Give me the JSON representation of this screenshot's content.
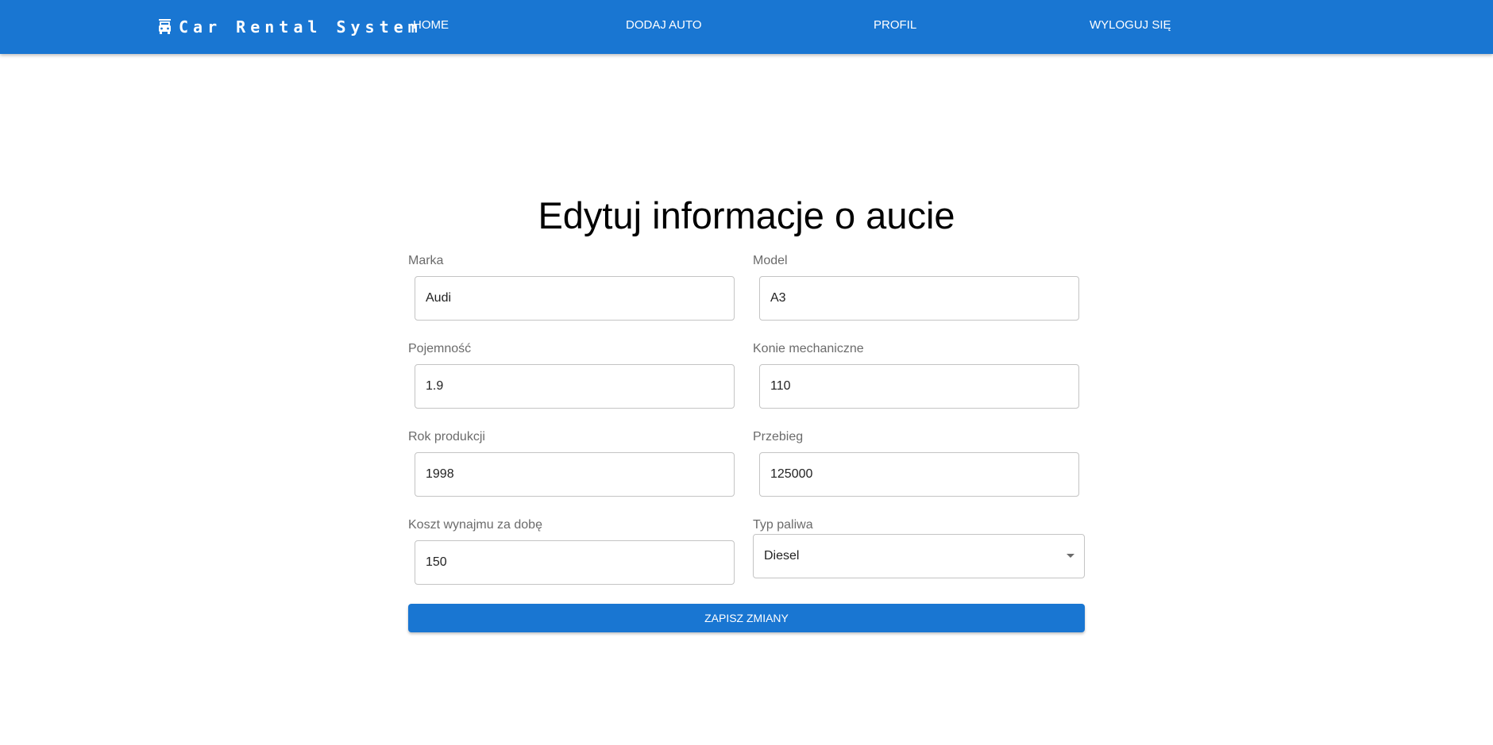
{
  "brand": {
    "icon": "car-icon",
    "title": "Car Rental System"
  },
  "nav": {
    "home": "HOME",
    "add_car": "DODAJ AUTO",
    "profile": "PROFIL",
    "logout": "WYLOGUJ SIĘ"
  },
  "page_title": "Edytuj informacje o aucie",
  "form": {
    "marka": {
      "label": "Marka",
      "value": "Audi"
    },
    "model": {
      "label": "Model",
      "value": "A3"
    },
    "pojemnosc": {
      "label": "Pojemność",
      "value": "1.9"
    },
    "konie": {
      "label": "Konie mechaniczne",
      "value": "110"
    },
    "rok": {
      "label": "Rok produkcji",
      "value": "1998"
    },
    "przebieg": {
      "label": "Przebieg",
      "value": "125000"
    },
    "koszt": {
      "label": "Koszt wynajmu za dobę",
      "value": "150"
    },
    "paliwo": {
      "label": "Typ paliwa",
      "value": "Diesel",
      "icon": "dropdown-arrow-icon"
    }
  },
  "submit_label": "ZAPISZ ZMIANY",
  "colors": {
    "primary": "#1976d2",
    "label": "#6b6b6b",
    "border": "#c4c4c4"
  }
}
